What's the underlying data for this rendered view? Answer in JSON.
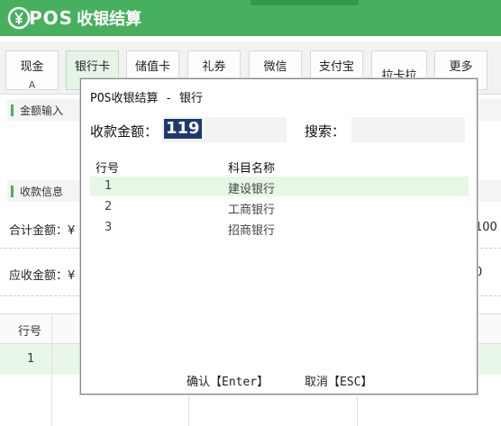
{
  "header": {
    "logo_text": "POS",
    "title": "收银结算"
  },
  "tabs": [
    {
      "label": "现金",
      "hotkey": "A"
    },
    {
      "label": "银行卡",
      "hotkey": ""
    },
    {
      "label": "储值卡",
      "hotkey": ""
    },
    {
      "label": "礼券",
      "hotkey": ""
    },
    {
      "label": "微信",
      "hotkey": ""
    },
    {
      "label": "支付宝",
      "hotkey": ""
    },
    {
      "label": "拉卡拉",
      "hotkey": ""
    },
    {
      "label": "更多",
      "hotkey": ""
    }
  ],
  "panels": {
    "amount_input": "金额输入",
    "payment_info": "收款信息",
    "total_label": "合计金额：¥",
    "total_right": "100",
    "receivable_label": "应收金额：¥",
    "receivable_right": "0"
  },
  "bg_table": {
    "header_col": "行号",
    "row_no": "1"
  },
  "dialog": {
    "title": "POS收银结算 - 银行",
    "amount_label": "收款金额：",
    "amount_value": "119",
    "search_label": "搜索：",
    "search_value": "",
    "columns": [
      "行号",
      "科目名称"
    ],
    "rows": [
      {
        "no": "1",
        "name": "建设银行"
      },
      {
        "no": "2",
        "name": "工商银行"
      },
      {
        "no": "3",
        "name": "招商银行"
      }
    ],
    "confirm_label": "确认【Enter】",
    "cancel_label": "取消【ESC】"
  },
  "colors": {
    "brand": "#47b05f",
    "selection": "#1c3a6e",
    "selected_row": "#e6f7e6"
  }
}
